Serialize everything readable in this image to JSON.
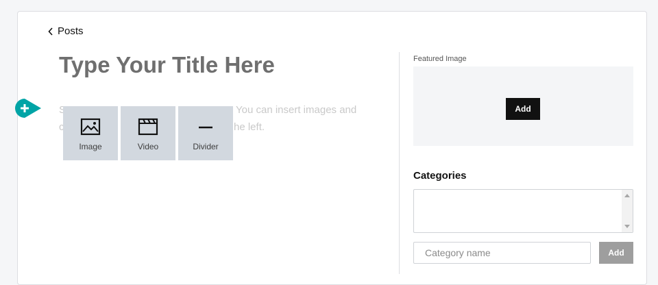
{
  "nav": {
    "back_label": "Posts",
    "back_icon": "chevron-left-icon"
  },
  "editor": {
    "title_placeholder": "Type Your Title Here",
    "body_visible_line1_left": "S",
    "body_visible_line1_right": "You can insert images and",
    "body_visible_line2_left": "c",
    "body_visible_line2_right": "he left.",
    "insert_icon": "plus-icon",
    "accent_color": "#00a4a6",
    "block_menu": [
      {
        "label": "Image",
        "icon": "image-icon"
      },
      {
        "label": "Video",
        "icon": "video-icon"
      },
      {
        "label": "Divider",
        "icon": "divider-icon"
      }
    ]
  },
  "sidebar": {
    "featured_image_label": "Featured Image",
    "featured_image_add_label": "Add",
    "categories_title": "Categories",
    "category_input_placeholder": "Category name",
    "category_add_label": "Add"
  }
}
